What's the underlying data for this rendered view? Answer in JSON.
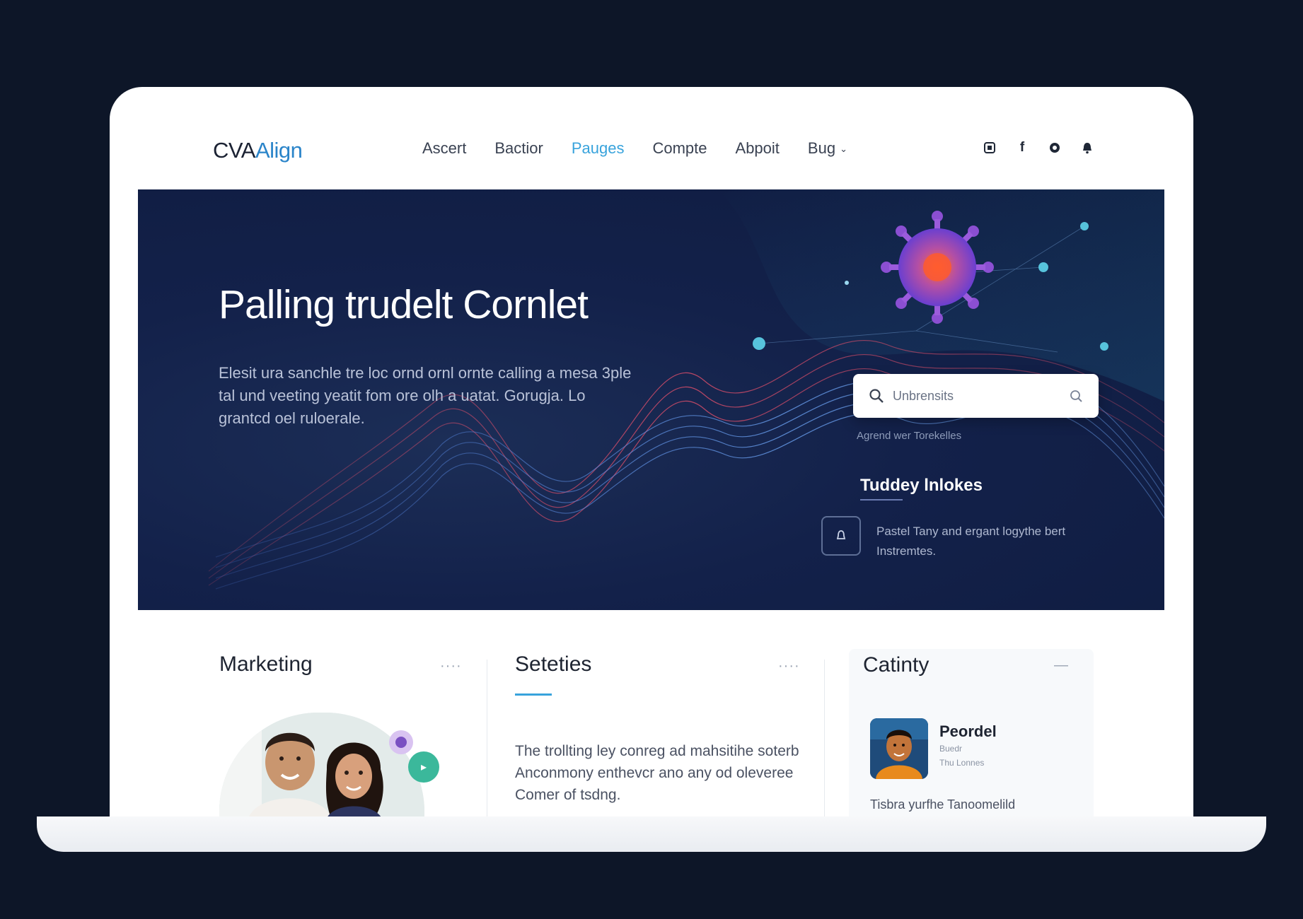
{
  "brand": {
    "part1": "CVA",
    "part2": "Align"
  },
  "nav": {
    "items": [
      "Ascert",
      "Bactior",
      "Pauges",
      "Compte",
      "Abpoit",
      "Bug"
    ],
    "active_index": 2
  },
  "social": {
    "icons": [
      "square-icon",
      "facebook-icon",
      "circle-icon",
      "bell-icon"
    ]
  },
  "hero": {
    "title": "Palling trudelt Cornlet",
    "description": "Elesit ura sanchle tre loc ornd ornl ornte calling a mesa 3ple tal und veeting yeatit fom ore olh a uatat. Gorugja. Lo grantcd oel ruloerale.",
    "search_placeholder": "Unbrensits",
    "search_hint": "Agrend wer Torekelles",
    "trending_title": "Tuddey lnlokes",
    "trending_item": "Pastel Tany and ergant logythe bert Instremtes."
  },
  "cards": {
    "marketing": {
      "title": "Marketing",
      "menu": "····"
    },
    "services": {
      "title": "Seteties",
      "menu": "····",
      "text": "The trollting ley conreg ad mahsitihe soterb Anconmony enthevcr ano any od oleveree Comer of tsdng."
    },
    "catinty": {
      "title": "Catinty",
      "menu": "—",
      "name": "Peordel",
      "sub1": "Buedr",
      "sub2": "Thu Lonnes",
      "text": "Tisbra yurfhe Tanoomelild"
    }
  },
  "colors": {
    "accent": "#38a3dc",
    "hero_bg": "#13214a",
    "page_bg": "#0d1628"
  }
}
